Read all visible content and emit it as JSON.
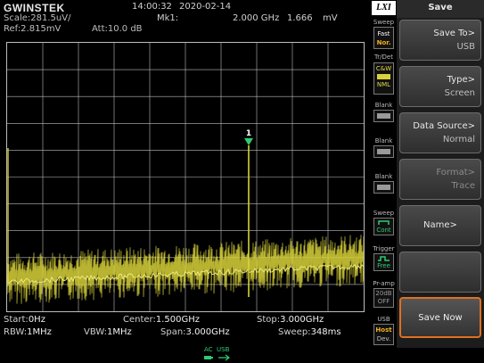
{
  "header": {
    "logo": "GWINSTEK",
    "time": "14:00:32",
    "date": "2020-02-14",
    "scale": "Scale:281.5uV/",
    "ref": "Ref:2.815mV",
    "att": "Att:10.0 dB",
    "marker_label": "Mk1:",
    "marker_freq": "2.000 GHz",
    "marker_amp": "1.666",
    "marker_unit": "mV",
    "lxi": "LXI"
  },
  "plot": {
    "marker_number": "1",
    "colors": {
      "trace": "#d8d23a",
      "grid": "#bdbdbd",
      "marker": "#2ecc71"
    }
  },
  "info": {
    "start_label": "Start:",
    "start_val": "0Hz",
    "center_label": "Center:",
    "center_val": "1.500GHz",
    "stop_label": "Stop:",
    "stop_val": "3.000GHz",
    "rbw_label": "RBW:",
    "rbw_val": "1MHz",
    "vbw_label": "VBW:",
    "vbw_val": "1MHz",
    "span_label": "Span:",
    "span_val": "3.000GHz",
    "sweep_label": "Sweep:",
    "sweep_val": "348ms"
  },
  "status": {
    "sweep": "Sweep",
    "fast": "Fast",
    "nor": "Nor.",
    "trdet": "Tr/Det",
    "cw": "C&W",
    "nml": "NML",
    "blank1": "Blank",
    "blank2": "Blank",
    "blank3": "Blank",
    "sweep2": "Sweep",
    "cont": "Cont",
    "trigger": "Trigger",
    "free": "Free",
    "pramp": "Pr-amp",
    "db": "20dB",
    "off": "OFF",
    "usb": "USB",
    "host": "Host",
    "dev": "Dev."
  },
  "menu": {
    "title": "Save",
    "save_to": "Save To>",
    "save_to_val": "USB",
    "type": "Type>",
    "type_val": "Screen",
    "data_source": "Data Source>",
    "data_source_val": "Normal",
    "format": "Format>",
    "format_val": "Trace",
    "name": "Name>",
    "save_now": "Save Now"
  },
  "footer": {
    "ac": "AC",
    "usb": "USB"
  }
}
